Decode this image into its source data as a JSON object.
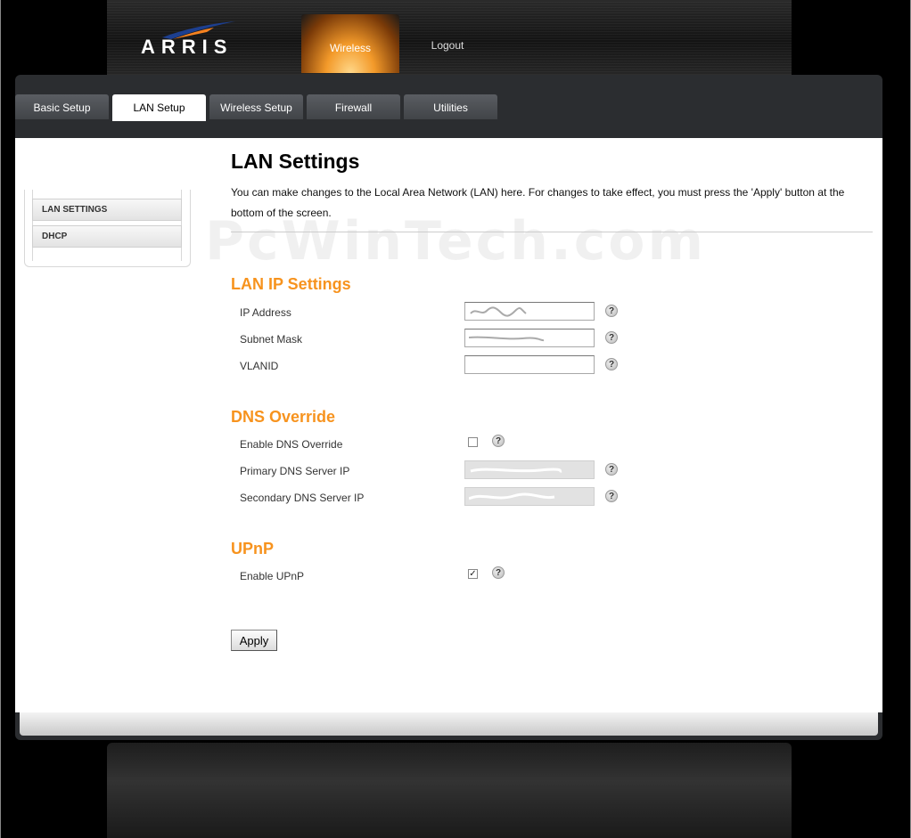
{
  "header": {
    "logo_text": "ARRIS",
    "nav": [
      {
        "label": "Wireless"
      },
      {
        "label": "Logout"
      }
    ]
  },
  "tabs": [
    {
      "label": "Basic Setup",
      "active": false
    },
    {
      "label": "LAN Setup",
      "active": true
    },
    {
      "label": "Wireless Setup",
      "active": false
    },
    {
      "label": "Firewall",
      "active": false
    },
    {
      "label": "Utilities",
      "active": false
    }
  ],
  "sidebar": {
    "items": [
      {
        "label": "LAN SETTINGS"
      },
      {
        "label": "DHCP"
      }
    ]
  },
  "main": {
    "title": "LAN Settings",
    "description": "You can make changes to the Local Area Network (LAN) here. For changes to take effect, you must press the 'Apply' button at the bottom of the screen.",
    "watermark": "PcWinTech.com",
    "sections": {
      "lan_ip": {
        "title": "LAN IP Settings",
        "ip_label": "IP Address",
        "subnet_label": "Subnet Mask",
        "vlanid_label": "VLANID",
        "vlanid_value": ""
      },
      "dns": {
        "title": "DNS Override",
        "enable_label": "Enable DNS Override",
        "enable_checked": false,
        "primary_label": "Primary DNS Server IP",
        "secondary_label": "Secondary DNS Server IP"
      },
      "upnp": {
        "title": "UPnP",
        "enable_label": "Enable UPnP",
        "enable_checked": true
      }
    },
    "help_glyph": "?",
    "apply_label": "Apply"
  },
  "colors": {
    "accent": "#f7931e",
    "frame": "#2b2d30",
    "tab": "#4a4d52"
  },
  "icons": [
    "help-icon",
    "arris-logo-swoosh"
  ]
}
